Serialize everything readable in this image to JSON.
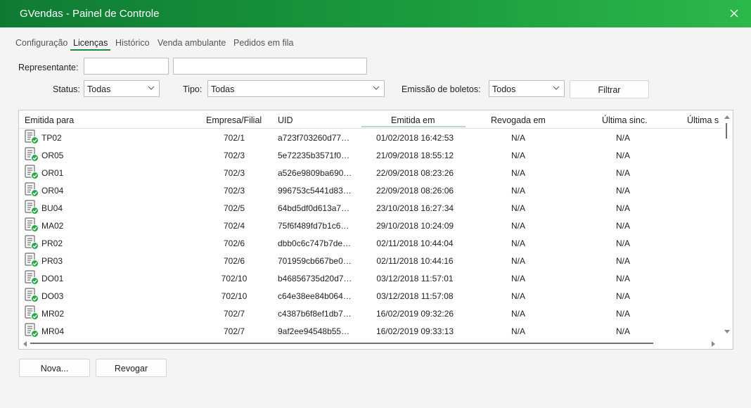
{
  "window": {
    "title": "GVendas - Painel de Controle"
  },
  "tabs": [
    {
      "label": "Configuração",
      "active": false
    },
    {
      "label": "Licenças",
      "active": true
    },
    {
      "label": "Histórico",
      "active": false
    },
    {
      "label": "Venda ambulante",
      "active": false
    },
    {
      "label": "Pedidos em fila",
      "active": false
    }
  ],
  "filters": {
    "representante_label": "Representante:",
    "representante_code": "",
    "representante_name": "",
    "status_label": "Status:",
    "status_value": "Todas",
    "tipo_label": "Tipo:",
    "tipo_value": "Todas",
    "emissao_label": "Emissão de boletos:",
    "emissao_value": "Todos",
    "filtrar_label": "Filtrar"
  },
  "table": {
    "columns": [
      "Emitida para",
      "Empresa/Filial",
      "UID",
      "Emitida em",
      "Revogada em",
      "Última sinc.",
      "Última s"
    ],
    "rows": [
      {
        "name": "TP02",
        "empresa": "702/1",
        "uid": "a723f703260d77…",
        "emitida": "01/02/2018 16:42:53",
        "revogada": "N/A",
        "sinc": "N/A"
      },
      {
        "name": "OR05",
        "empresa": "702/3",
        "uid": "5e72235b3571f0…",
        "emitida": "21/09/2018 18:55:12",
        "revogada": "N/A",
        "sinc": "N/A"
      },
      {
        "name": "OR01",
        "empresa": "702/3",
        "uid": "a526e9809ba690…",
        "emitida": "22/09/2018 08:23:26",
        "revogada": "N/A",
        "sinc": "N/A"
      },
      {
        "name": "OR04",
        "empresa": "702/3",
        "uid": "996753c5441d83…",
        "emitida": "22/09/2018 08:26:06",
        "revogada": "N/A",
        "sinc": "N/A"
      },
      {
        "name": "BU04",
        "empresa": "702/5",
        "uid": "64bd5df0d613a7…",
        "emitida": "23/10/2018 16:27:34",
        "revogada": "N/A",
        "sinc": "N/A"
      },
      {
        "name": "MA02",
        "empresa": "702/4",
        "uid": "75f6f489fd7b1c6…",
        "emitida": "29/10/2018 10:24:09",
        "revogada": "N/A",
        "sinc": "N/A"
      },
      {
        "name": "PR02",
        "empresa": "702/6",
        "uid": "dbb0c6c747b7de…",
        "emitida": "02/11/2018 10:44:04",
        "revogada": "N/A",
        "sinc": "N/A"
      },
      {
        "name": "PR03",
        "empresa": "702/6",
        "uid": "701959cb667be0…",
        "emitida": "02/11/2018 10:44:16",
        "revogada": "N/A",
        "sinc": "N/A"
      },
      {
        "name": "DO01",
        "empresa": "702/10",
        "uid": "b46856735d20d7…",
        "emitida": "03/12/2018 11:57:01",
        "revogada": "N/A",
        "sinc": "N/A"
      },
      {
        "name": "DO03",
        "empresa": "702/10",
        "uid": "c64e38ee84b064…",
        "emitida": "03/12/2018 11:57:08",
        "revogada": "N/A",
        "sinc": "N/A"
      },
      {
        "name": "MR02",
        "empresa": "702/7",
        "uid": "c4387b6f8ef1db7…",
        "emitida": "16/02/2019 09:32:26",
        "revogada": "N/A",
        "sinc": "N/A"
      },
      {
        "name": "MR04",
        "empresa": "702/7",
        "uid": "9af2ee94548b55…",
        "emitida": "16/02/2019 09:33:13",
        "revogada": "N/A",
        "sinc": "N/A"
      }
    ]
  },
  "buttons": {
    "nova": "Nova...",
    "revogar": "Revogar"
  },
  "colors": {
    "accent": "#1b9a3e",
    "status_ok": "#2aa64a"
  },
  "icons": {
    "row_icon": "license-valid-icon",
    "close": "close-icon"
  }
}
